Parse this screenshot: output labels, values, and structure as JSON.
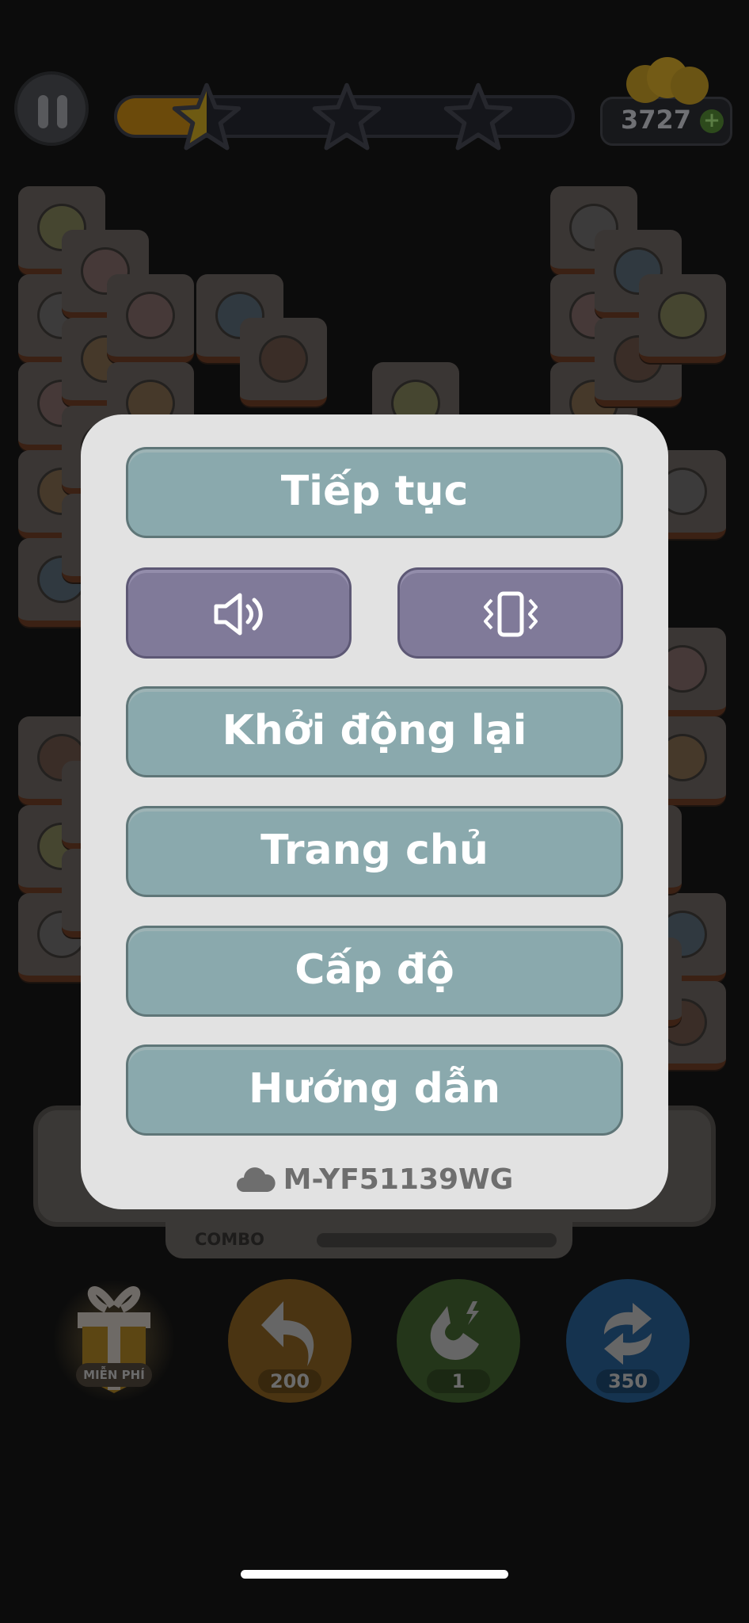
{
  "hud": {
    "coins": "3727",
    "progress_fraction": 0.18,
    "stars_earned": 0.5,
    "plus_label": "+"
  },
  "menu": {
    "resume": "Tiếp tục",
    "sound_icon": "speaker-icon",
    "vibrate_icon": "vibrate-icon",
    "restart": "Khởi động lại",
    "home": "Trang chủ",
    "level": "Cấp độ",
    "guide": "Hướng dẫn",
    "player_id": "M-YF51139WG"
  },
  "combo_label": "COMBO",
  "tools": {
    "gift_label": "MIỄN PHÍ",
    "undo_cost": "200",
    "magnet_count": "1",
    "shuffle_cost": "350"
  },
  "colors": {
    "button": "#8aa9ad",
    "toggle": "#807a99",
    "dialog": "#e2e2e2"
  }
}
